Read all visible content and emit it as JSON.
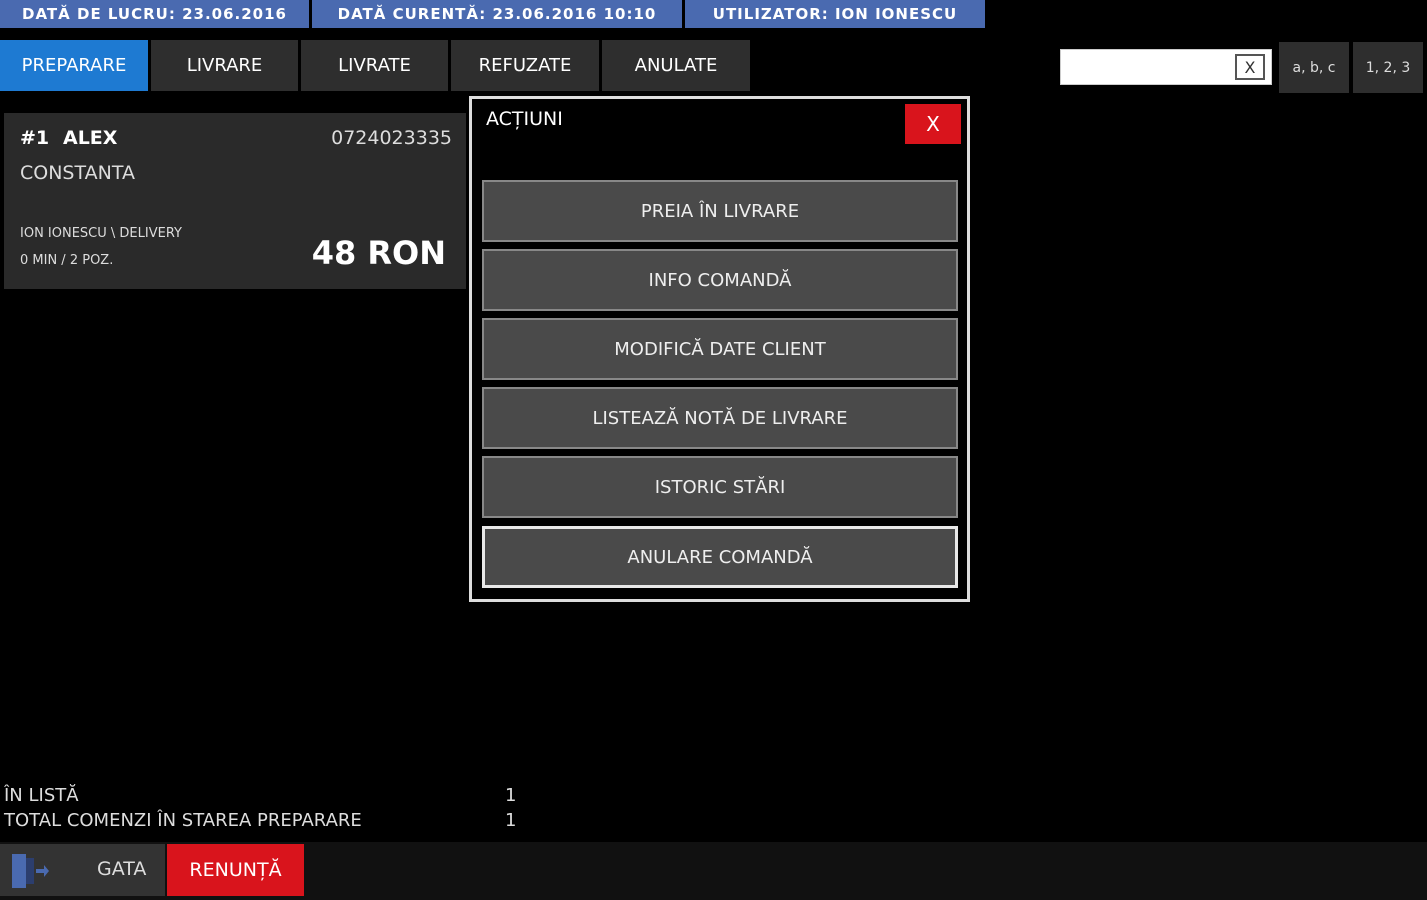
{
  "info_bar": {
    "work_date": "DATĂ DE LUCRU: 23.06.2016",
    "current_date": "DATĂ CURENTĂ: 23.06.2016 10:10",
    "user": "UTILIZATOR: ION IONESCU"
  },
  "tabs": [
    {
      "label": "PREPARARE",
      "active": true
    },
    {
      "label": "LIVRARE"
    },
    {
      "label": "LIVRATE"
    },
    {
      "label": "REFUZATE"
    },
    {
      "label": "ANULATE"
    }
  ],
  "search": {
    "value": "",
    "clear_label": "X"
  },
  "keyboard_modes": {
    "letters": "a, b, c",
    "numbers": "1, 2, 3"
  },
  "order": {
    "number": "#1",
    "name": "ALEX",
    "phone": "0724023335",
    "city": "CONSTANTA",
    "operator": "ION IONESCU \\ DELIVERY",
    "time_items": "0 MIN / 2 POZ.",
    "total": "48 RON"
  },
  "modal": {
    "title": "ACȚIUNI",
    "close_label": "X",
    "actions": [
      "PREIA ÎN LIVRARE",
      "INFO COMANDĂ",
      "MODIFICĂ DATE CLIENT",
      "LISTEAZĂ NOTĂ DE LIVRARE",
      "ISTORIC STĂRI",
      "ANULARE COMANDĂ"
    ]
  },
  "summary": {
    "in_list_label": "ÎN LISTĂ",
    "in_list_value": "1",
    "total_label": "TOTAL COMENZI ÎN STAREA PREPARARE",
    "total_value": "1"
  },
  "bottom": {
    "done_label": "GATA",
    "cancel_label": "RENUNȚĂ"
  },
  "colors": {
    "accent_blue": "#1e7ad2",
    "info_bar": "#4a6ab0",
    "danger_red": "#d9141c"
  }
}
